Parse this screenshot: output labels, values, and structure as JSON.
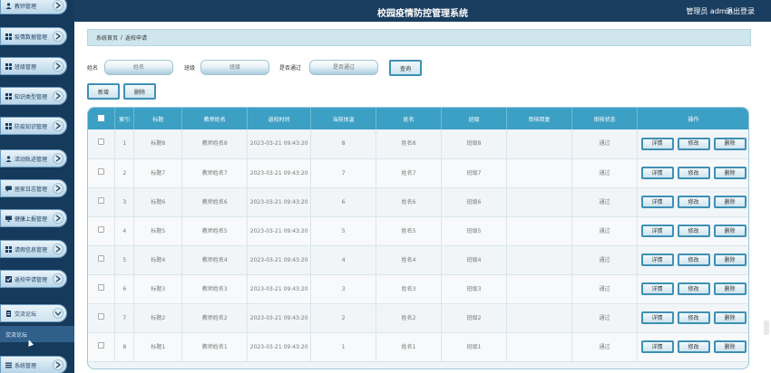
{
  "header": {
    "title": "校园疫情防控管理系统",
    "user": "管理员 admin",
    "logout": "退出登录"
  },
  "sidebar": {
    "items": [
      {
        "label": "教师管理",
        "icon": "person-icon"
      },
      {
        "label": "疫情数据管理",
        "icon": "grid-icon"
      },
      {
        "label": "班级管理",
        "icon": "grid-icon"
      },
      {
        "label": "知识类型管理",
        "icon": "grid-icon"
      },
      {
        "label": "防疫知识管理",
        "icon": "grid-icon"
      },
      {
        "label": "活动轨迹管理",
        "icon": "person-icon"
      },
      {
        "label": "居家日志管理",
        "icon": "chat-icon"
      },
      {
        "label": "健康上报管理",
        "icon": "monitor-icon"
      },
      {
        "label": "请假信息管理",
        "icon": "grid-icon"
      },
      {
        "label": "返校申请管理",
        "icon": "check-icon"
      },
      {
        "label": "交流论坛",
        "icon": "doc-icon"
      },
      {
        "label": "系统管理",
        "icon": "list-icon"
      }
    ],
    "sub_item": "交流论坛"
  },
  "breadcrumb": {
    "home": "系统首页",
    "sep": "/",
    "current": "返校申请"
  },
  "search": {
    "name_label": "姓名",
    "name_placeholder": "姓名",
    "class_label": "班级",
    "class_placeholder": "班级",
    "pass_label": "是否通过",
    "pass_placeholder": "是否通过",
    "query_label": "查询"
  },
  "actions": {
    "add_label": "新增",
    "delete_label": "删除"
  },
  "table": {
    "headers": [
      "索引",
      "标题",
      "教师姓名",
      "返校时间",
      "当前体温",
      "姓名",
      "班级",
      "审核回复",
      "审核状态",
      "操作"
    ],
    "ops": {
      "detail": "详情",
      "edit": "修改",
      "delete": "删除"
    },
    "rows": [
      {
        "idx": "1",
        "title": "标题8",
        "teacher": "教师姓名8",
        "time": "2023-03-21 09:43:20",
        "temp": "8",
        "name": "姓名8",
        "class": "班级8",
        "reply": "",
        "status": "通过"
      },
      {
        "idx": "2",
        "title": "标题7",
        "teacher": "教师姓名7",
        "time": "2023-03-21 09:43:20",
        "temp": "7",
        "name": "姓名7",
        "class": "班级7",
        "reply": "",
        "status": "通过"
      },
      {
        "idx": "3",
        "title": "标题6",
        "teacher": "教师姓名6",
        "time": "2023-03-21 09:43:20",
        "temp": "6",
        "name": "姓名6",
        "class": "班级6",
        "reply": "",
        "status": "通过"
      },
      {
        "idx": "4",
        "title": "标题5",
        "teacher": "教师姓名5",
        "time": "2023-03-21 09:43:20",
        "temp": "5",
        "name": "姓名5",
        "class": "班级5",
        "reply": "",
        "status": "通过"
      },
      {
        "idx": "5",
        "title": "标题4",
        "teacher": "教师姓名4",
        "time": "2023-03-21 09:43:20",
        "temp": "4",
        "name": "姓名4",
        "class": "班级4",
        "reply": "",
        "status": "通过"
      },
      {
        "idx": "6",
        "title": "标题3",
        "teacher": "教师姓名3",
        "time": "2023-03-21 09:43:20",
        "temp": "3",
        "name": "姓名3",
        "class": "班级3",
        "reply": "",
        "status": "通过"
      },
      {
        "idx": "7",
        "title": "标题2",
        "teacher": "教师姓名2",
        "time": "2023-03-21 09:43:20",
        "temp": "2",
        "name": "姓名2",
        "class": "班级2",
        "reply": "",
        "status": "通过"
      },
      {
        "idx": "8",
        "title": "标题1",
        "teacher": "教师姓名1",
        "time": "2023-03-21 09:43:20",
        "temp": "1",
        "name": "姓名1",
        "class": "班级1",
        "reply": "",
        "status": "通过"
      }
    ]
  },
  "colors": {
    "header_bg": "#1a3e60",
    "sidebar_bg": "#163a5c",
    "table_header": "#3c9fc4",
    "breadcrumb_bg": "#cfe6ee"
  }
}
